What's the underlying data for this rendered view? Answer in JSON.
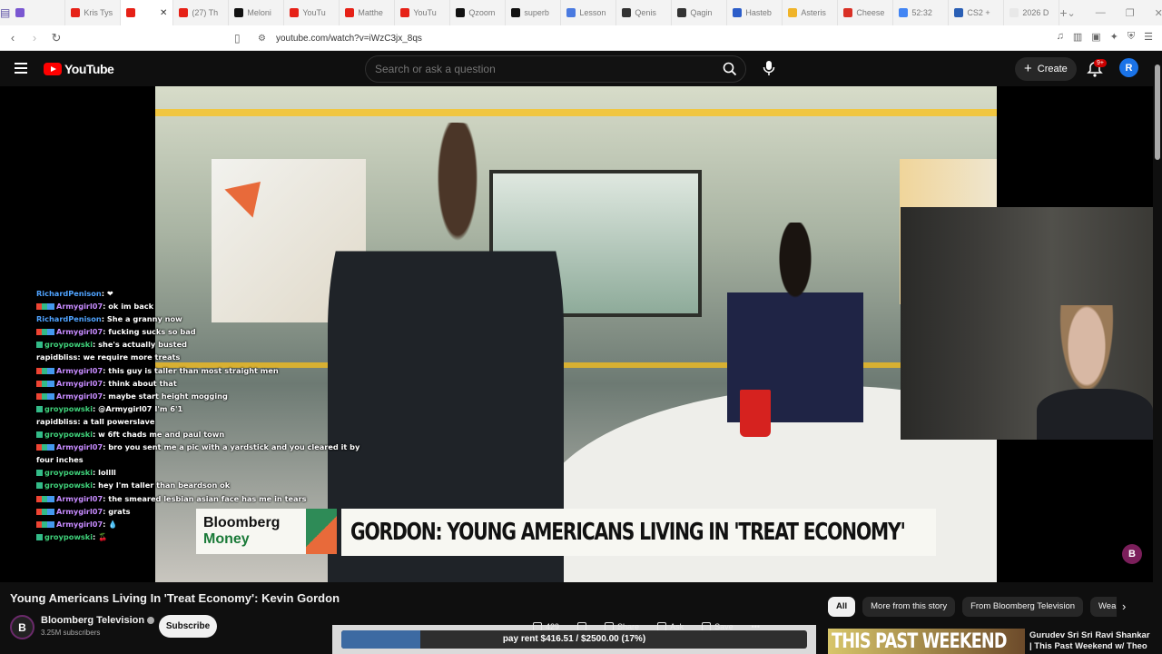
{
  "browser": {
    "tabs": [
      {
        "label": "",
        "color": "#7a57d1"
      },
      {
        "label": "Kris Tys",
        "color": "#e62117"
      },
      {
        "label": "",
        "color": "#e62117",
        "active": true
      },
      {
        "label": "(27) Th",
        "color": "#e62117"
      },
      {
        "label": "Meloni",
        "color": "#111111"
      },
      {
        "label": "YouTu",
        "color": "#e62117"
      },
      {
        "label": "Matthe",
        "color": "#e62117"
      },
      {
        "label": "YouTu",
        "color": "#e62117"
      },
      {
        "label": "Qzoom",
        "color": "#111111"
      },
      {
        "label": "superb",
        "color": "#111111"
      },
      {
        "label": "Lesson",
        "color": "#4a7ae0"
      },
      {
        "label": "Qenis",
        "color": "#333333"
      },
      {
        "label": "Qagin",
        "color": "#333333"
      },
      {
        "label": "Hasteb",
        "color": "#2c5dc9"
      },
      {
        "label": "Asteris",
        "color": "#f0b429"
      },
      {
        "label": "Cheese",
        "color": "#d93025"
      },
      {
        "label": "52:32",
        "color": "#4285f4"
      },
      {
        "label": "CS2 +",
        "color": "#2a5fb5"
      },
      {
        "label": "2026 D",
        "color": "#e8e8e8"
      }
    ],
    "url": "youtube.com/watch?v=iWzC3jx_8qs"
  },
  "header": {
    "logo_text": "YouTube",
    "search_placeholder": "Search or ask a question",
    "create_label": "Create",
    "notifications_badge": "9+",
    "user_initial": "R"
  },
  "video": {
    "chyron_brand_line1": "Bloomberg",
    "chyron_brand_line2": "Money",
    "chyron_headline": "GORDON: YOUNG AMERICANS LIVING IN 'TREAT ECONOMY'",
    "player_badge": "B",
    "title": "Young Americans Living In 'Treat Economy': Kevin Gordon"
  },
  "chat": [
    {
      "user": "RichardPenison",
      "class": "u-rich",
      "badges": "none",
      "msg": "❤"
    },
    {
      "user": "Armygirl07",
      "class": "u-army",
      "badges": "multi",
      "msg": "ok im back"
    },
    {
      "user": "RichardPenison",
      "class": "u-rich",
      "badges": "none",
      "msg": "She a granny now"
    },
    {
      "user": "Armygirl07",
      "class": "u-army",
      "badges": "multi",
      "msg": "fucking sucks so bad"
    },
    {
      "user": "groypowski",
      "class": "u-groy",
      "badges": "single",
      "msg": "she's actually busted"
    },
    {
      "user": "rapidbliss",
      "class": "u-rapid",
      "badges": "none",
      "msg": "we require more treats"
    },
    {
      "user": "Armygirl07",
      "class": "u-army",
      "badges": "multi",
      "msg": "this guy is taller than most straight men"
    },
    {
      "user": "Armygirl07",
      "class": "u-army",
      "badges": "multi",
      "msg": "think about that"
    },
    {
      "user": "Armygirl07",
      "class": "u-army",
      "badges": "multi",
      "msg": "maybe start height mogging"
    },
    {
      "user": "groypowski",
      "class": "u-groy",
      "badges": "single",
      "msg": "@Armygirl07 I'm 6'1"
    },
    {
      "user": "rapidbliss",
      "class": "u-rapid",
      "badges": "none",
      "msg": "a tall powerslave"
    },
    {
      "user": "groypowski",
      "class": "u-groy",
      "badges": "single",
      "msg": "w 6ft chads me and paul town"
    },
    {
      "user": "Armygirl07",
      "class": "u-army",
      "badges": "multi",
      "msg": "bro you sent me a pic with a yardstick and you cleared it by four inches",
      "wrap": true
    },
    {
      "user": "groypowski",
      "class": "u-groy",
      "badges": "single",
      "msg": "lollll"
    },
    {
      "user": "groypowski",
      "class": "u-groy",
      "badges": "single",
      "msg": "hey I'm taller than beardson ok"
    },
    {
      "user": "Armygirl07",
      "class": "u-army",
      "badges": "multi",
      "msg": "the smeared lesbian asian face has me in tears"
    },
    {
      "user": "Armygirl07",
      "class": "u-army",
      "badges": "multi",
      "msg": "grats"
    },
    {
      "user": "Armygirl07",
      "class": "u-army",
      "badges": "multi",
      "msg": "💧"
    },
    {
      "user": "groypowski",
      "class": "u-groy",
      "badges": "single",
      "msg": "🍒"
    }
  ],
  "channel": {
    "initial": "B",
    "name": "Bloomberg Television",
    "subscribers": "3.25M subscribers",
    "subscribe_label": "Subscribe"
  },
  "actions": {
    "like_count": "429",
    "share_label": "Share",
    "ask_label": "Ask",
    "save_label": "Save",
    "more_label": "•••"
  },
  "rent": {
    "text": "pay rent $416.51 / $2500.00 (17%)",
    "progress": 0.17
  },
  "chips": [
    "All",
    "More from this story",
    "From Bloomberg Television",
    "Wealth"
  ],
  "recommendation": {
    "thumb_text": "THIS PAST WEEKEND",
    "title": "Gurudev Sri Sri Ravi Shankar | This Past Weekend w/ Theo"
  }
}
